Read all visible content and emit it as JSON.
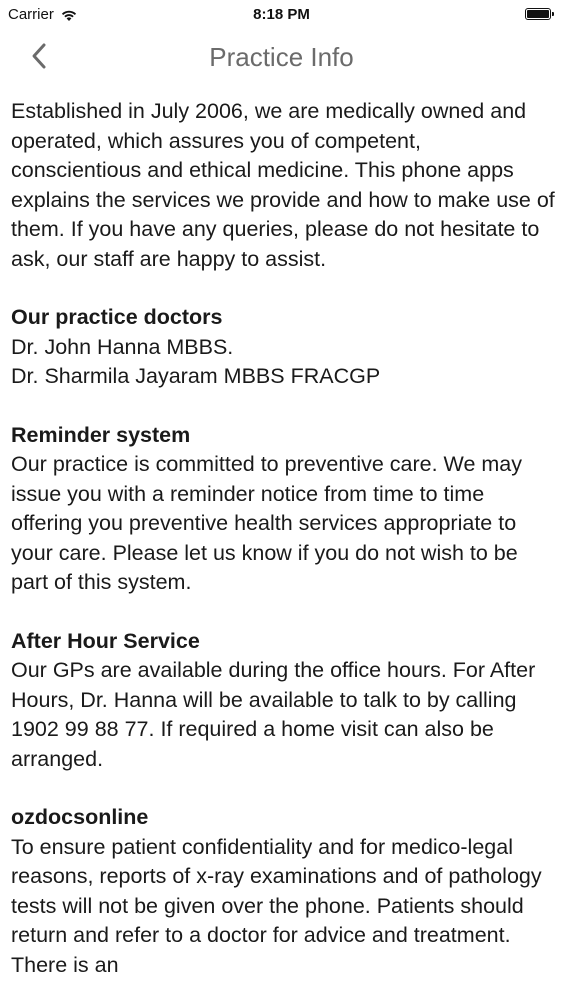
{
  "status_bar": {
    "carrier": "Carrier",
    "wifi_icon": "wifi-icon",
    "time": "8:18 PM",
    "battery_icon": "battery-icon",
    "battery_level": 1.0
  },
  "nav": {
    "back_icon": "chevron-left-icon",
    "title": "Practice Info"
  },
  "content": {
    "intro": "Established in July 2006, we are medically owned and operated, which assures you of competent, conscientious and ethical medicine.  This phone apps explains the services we provide and how to make use of them.  If you have any queries, please do not hesitate to ask, our staff are happy to assist.",
    "doctors_heading": "Our practice doctors",
    "doctors": [
      "Dr. John Hanna MBBS.",
      "Dr. Sharmila Jayaram MBBS FRACGP"
    ],
    "reminder_heading": "Reminder system",
    "reminder_text": "Our practice is committed to preventive care.  We may issue you with a reminder notice from time to time offering you preventive health services appropriate to your care. Please let us know if you do not wish to be part of this system.",
    "after_hours_heading": "After Hour Service",
    "after_hours_text": "Our GPs are available during the office hours. For After Hours, Dr. Hanna will be available to talk to by calling 1902 99 88 77.  If required a home visit can also be arranged.",
    "ozdocs_heading": "ozdocsonline",
    "ozdocs_text": "To ensure patient confidentiality and for medico-legal reasons, reports of x-ray examinations and of pathology tests will not be given over the phone.  Patients should return and refer to a doctor for advice and treatment.  There is an"
  }
}
